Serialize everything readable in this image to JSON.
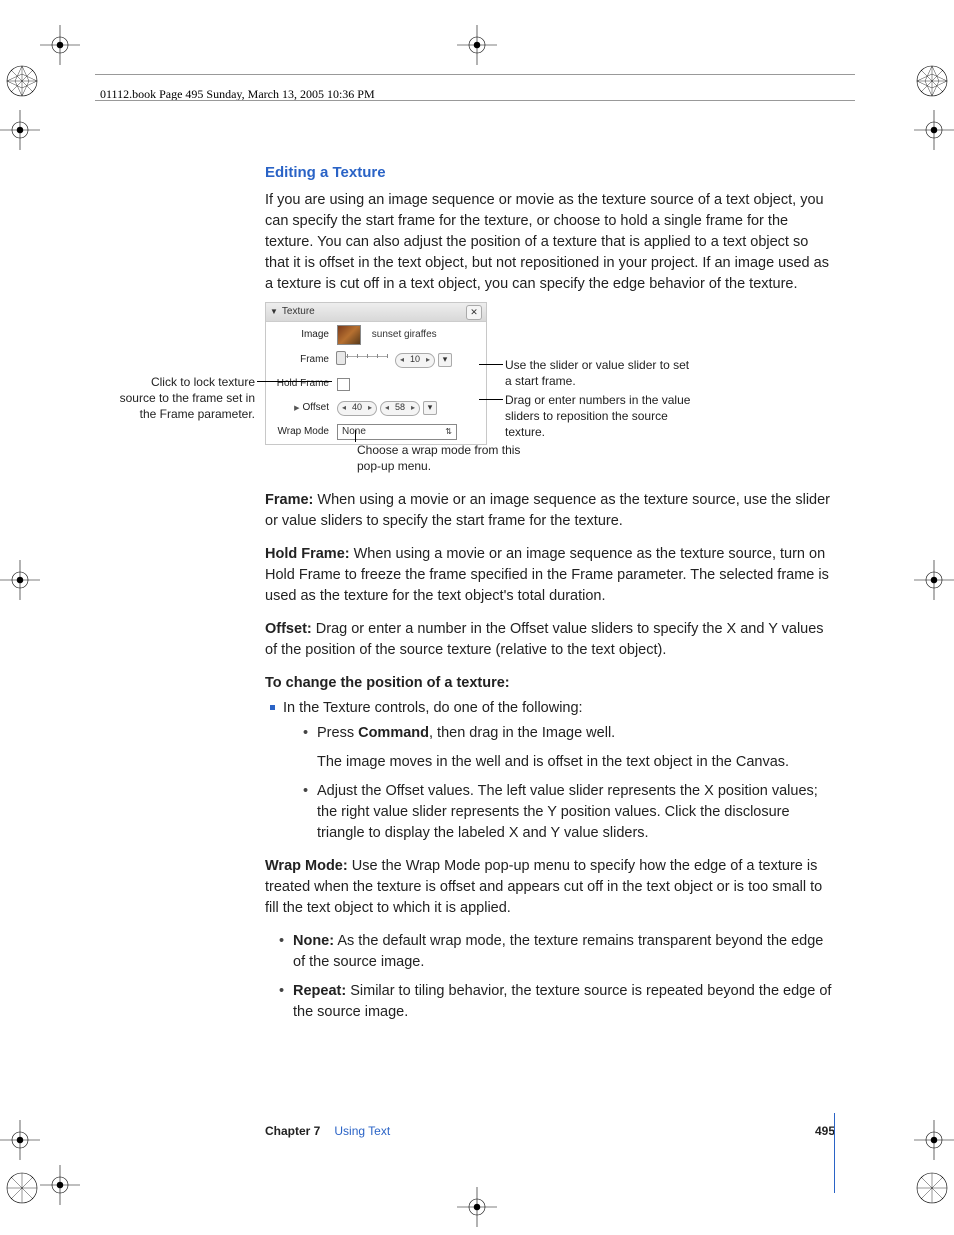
{
  "header": {
    "running": "01112.book  Page 495  Sunday, March 13, 2005  10:36 PM"
  },
  "section_title": "Editing a Texture",
  "intro_paragraph": "If you are using an image sequence or movie as the texture source of a text object, you can specify the start frame for the texture, or choose to hold a single frame for the texture. You can also adjust the position of a texture that is applied to a text object so that it is offset in the text object, but not repositioned in your project. If an image used as a texture is cut off in a text object, you can specify the edge behavior of the texture.",
  "panel": {
    "title": "Texture",
    "rows": {
      "image_label": "Image",
      "image_name": "sunset giraffes",
      "frame_label": "Frame",
      "frame_value": "10",
      "hold_label": "Hold Frame",
      "offset_label": "Offset",
      "offset_x": "40",
      "offset_y": "58",
      "wrap_label": "Wrap Mode",
      "wrap_value": "None"
    }
  },
  "callouts": {
    "left1": "Click to lock texture source to the frame set in the Frame parameter.",
    "right1": "Use the slider or value slider to set a start frame.",
    "right2": "Drag or enter numbers in the value sliders to reposition the source texture.",
    "bottom": "Choose a wrap mode from this pop-up menu."
  },
  "paragraphs": {
    "frame_label": "Frame:",
    "frame_text": "  When using a movie or an image sequence as the texture source, use the slider or value sliders to specify the start frame for the texture.",
    "hold_label": "Hold Frame:",
    "hold_text": "  When using a movie or an image sequence as the texture source, turn on Hold Frame to freeze the frame specified in the Frame parameter. The selected frame is used as the texture for the text object's total duration.",
    "offset_label": "Offset:",
    "offset_text": "  Drag or enter a number in the Offset value sliders to specify the X and Y values of the position of the source texture (relative to the text object).",
    "tochange": "To change the position of a texture:",
    "bullet_main": "In the Texture controls, do one of the following:",
    "sub1a": "Press ",
    "sub1b": "Command",
    "sub1c": ", then drag in the Image well.",
    "sub1_follow": "The image moves in the well and is offset in the text object in the Canvas.",
    "sub2": "Adjust the Offset values. The left value slider represents the X position values; the right value slider represents the Y position values. Click the disclosure triangle to display the labeled X and Y value sliders.",
    "wrap_label": "Wrap Mode:",
    "wrap_text": "  Use the Wrap Mode pop-up menu to specify how the edge of a texture is treated when the texture is offset and appears cut off in the text object or is too small to fill the text object to which it is applied.",
    "wm_none_label": "None:",
    "wm_none_text": "  As the default wrap mode, the texture remains transparent beyond the edge of the source image.",
    "wm_repeat_label": "Repeat:",
    "wm_repeat_text": "  Similar to tiling behavior, the texture source is repeated beyond the edge of the source image."
  },
  "footer": {
    "chapter": "Chapter 7",
    "title": "Using Text",
    "page": "495"
  }
}
